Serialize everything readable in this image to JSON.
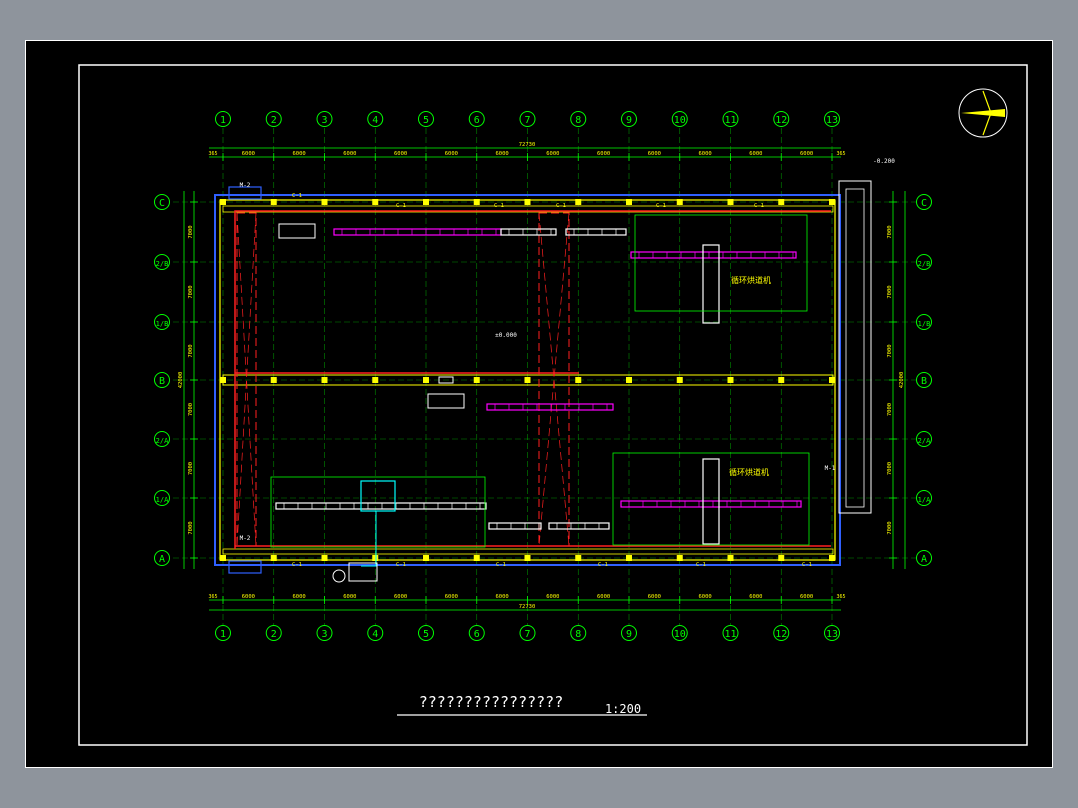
{
  "axes_x": [
    "1",
    "2",
    "3",
    "4",
    "5",
    "6",
    "7",
    "8",
    "9",
    "10",
    "11",
    "12",
    "13"
  ],
  "axes_y": [
    "C",
    "2/B",
    "1/B",
    "B",
    "2/A",
    "1/A",
    "A"
  ],
  "dim_x_segments": [
    "6000",
    "6000",
    "6000",
    "6000",
    "6000",
    "6000",
    "6000",
    "6000",
    "6000",
    "6000",
    "6000",
    "6000"
  ],
  "dim_total": "72730",
  "dim_end_left": "365",
  "dim_end_right": "365",
  "dim_y_segments": [
    "7000",
    "7000",
    "7000",
    "7000",
    "7000",
    "7000"
  ],
  "dim_y_total": "42000",
  "elevation_floor": "±0.000",
  "elevation_outside": "-0.200",
  "label_m2": "M-2",
  "label_m1": "M-1",
  "label_c1": "C-1",
  "title_text": "????????????????",
  "scale_text": "1:200",
  "equipment_label_top": "循环烘道机",
  "equipment_label_bottom": "循环烘道机",
  "colors": {
    "background": "#000000",
    "frame": "#ffffff",
    "axis_green": "#00ff00",
    "wall_yellow": "#ffff00",
    "wall_blue": "#3060ff",
    "red": "#ff2020",
    "magenta": "#ff00ff",
    "cyan": "#00ffff"
  }
}
